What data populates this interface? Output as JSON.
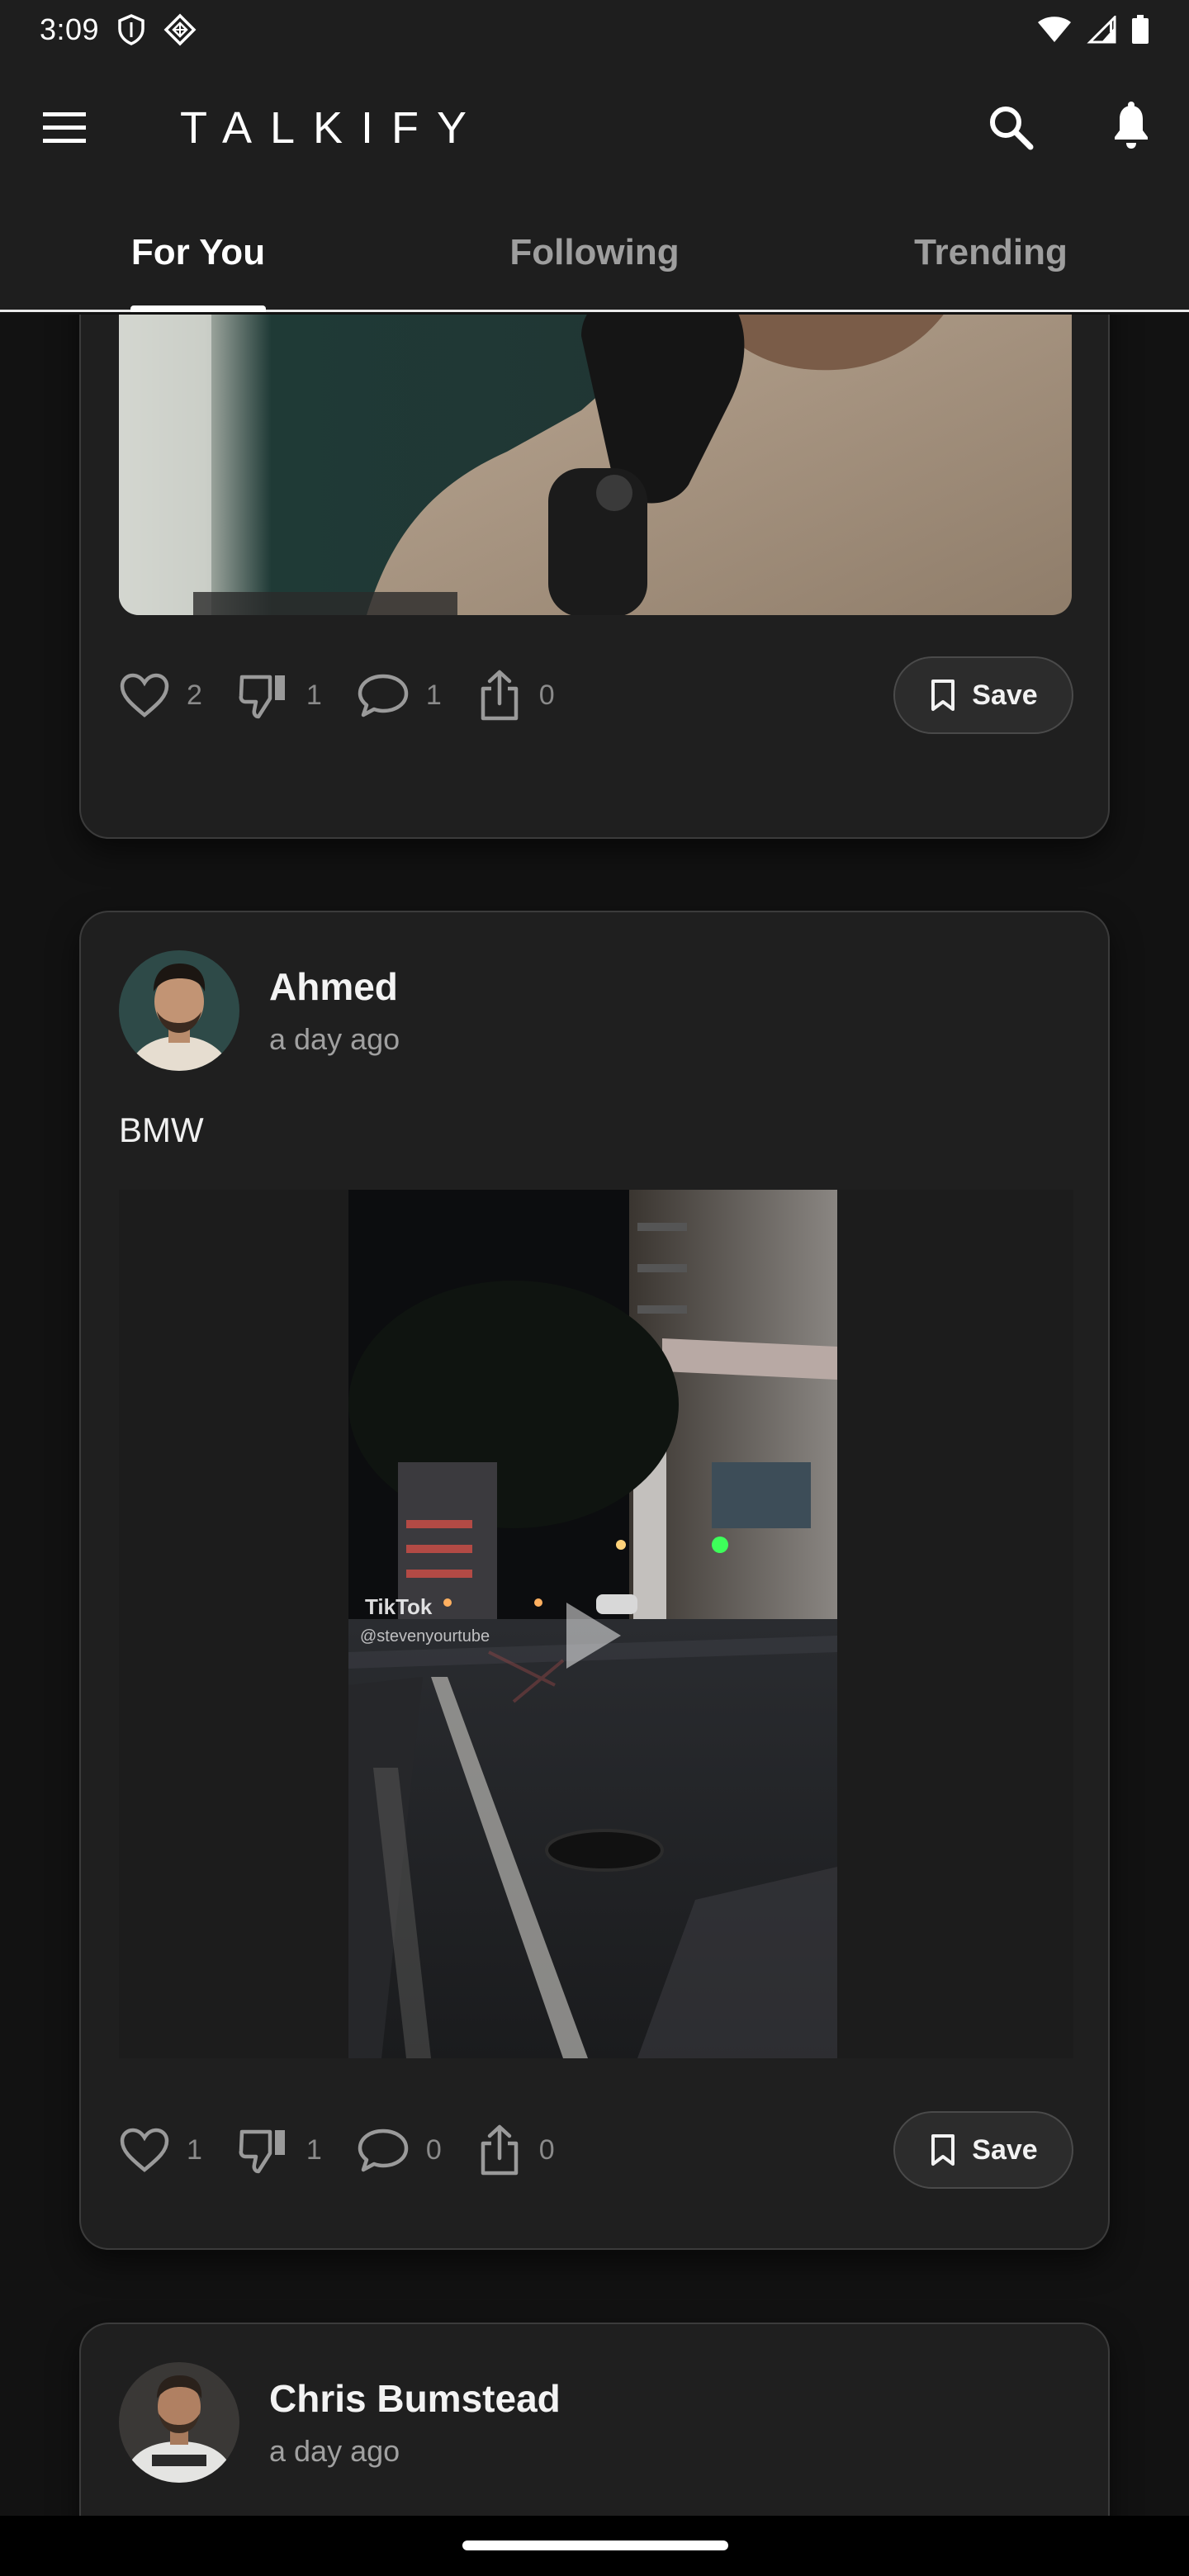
{
  "status_bar": {
    "time": "3:09",
    "left_icons": [
      "shield-icon",
      "diamond-grid-icon"
    ],
    "right_icons": [
      "wifi-icon",
      "signal-icon",
      "battery-icon"
    ]
  },
  "app_bar": {
    "title": "TALKIFY",
    "icons": [
      "menu-icon",
      "search-icon",
      "bell-icon"
    ]
  },
  "tabs": [
    {
      "label": "For You",
      "active": true
    },
    {
      "label": "Following",
      "active": false
    },
    {
      "label": "Trending",
      "active": false
    }
  ],
  "posts": [
    {
      "author": "",
      "time": "",
      "text": "",
      "media": "image",
      "likes": "2",
      "dislikes": "1",
      "comments": "1",
      "shares": "0",
      "save_label": "Save"
    },
    {
      "author": "Ahmed",
      "time": "a day ago",
      "text": "BMW",
      "media": "video",
      "watermark": "TikTok",
      "watermark_handle": "@stevenyourtube",
      "likes": "1",
      "dislikes": "1",
      "comments": "0",
      "shares": "0",
      "save_label": "Save"
    },
    {
      "author": "Chris Bumstead",
      "time": "a day ago"
    }
  ],
  "colors": {
    "background": "#121212",
    "surface": "#1e1e1e",
    "card": "#1f1f1f",
    "muted_text": "#8a8a8a",
    "accent": "#ffffff"
  }
}
